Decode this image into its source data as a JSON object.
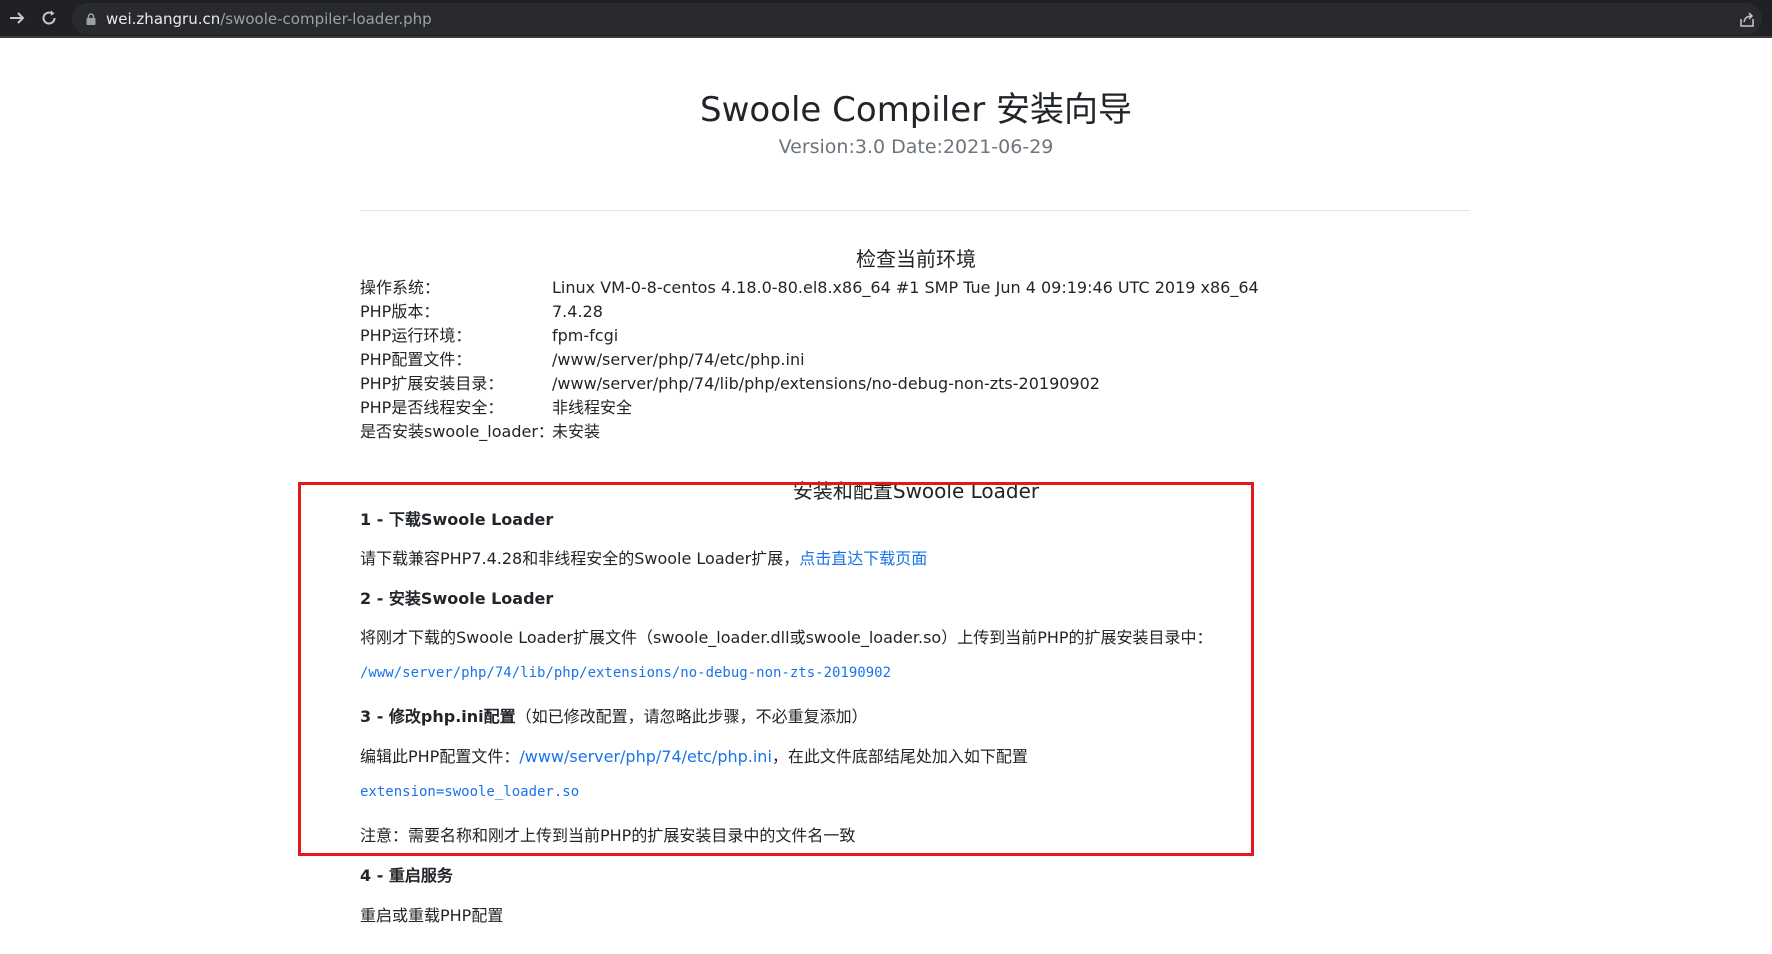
{
  "browser": {
    "url_host": "wei.zhangru.cn",
    "url_path": "/swoole-compiler-loader.php"
  },
  "header": {
    "title": "Swoole Compiler 安装向导",
    "subtitle": "Version:3.0 Date:2021-06-29"
  },
  "environment": {
    "title": "检查当前环境",
    "rows": [
      {
        "label": "操作系统：",
        "value": "Linux VM-0-8-centos 4.18.0-80.el8.x86_64 #1 SMP Tue Jun 4 09:19:46 UTC 2019 x86_64"
      },
      {
        "label": "PHP版本：",
        "value": "7.4.28"
      },
      {
        "label": "PHP运行环境：",
        "value": "fpm-fcgi"
      },
      {
        "label": "PHP配置文件：",
        "value": "/www/server/php/74/etc/php.ini"
      },
      {
        "label": "PHP扩展安装目录：",
        "value": "/www/server/php/74/lib/php/extensions/no-debug-non-zts-20190902"
      },
      {
        "label": "PHP是否线程安全：",
        "value": "非线程安全"
      },
      {
        "label": "是否安装swoole_loader：",
        "value": "未安装"
      }
    ]
  },
  "install": {
    "title": "安装和配置Swoole Loader",
    "step1": {
      "heading": "1 - 下载Swoole Loader",
      "text": "请下载兼容PHP7.4.28和非线程安全的Swoole Loader扩展，",
      "link": "点击直达下载页面"
    },
    "step2": {
      "heading": "2 - 安装Swoole Loader",
      "text": "将刚才下载的Swoole Loader扩展文件（swoole_loader.dll或swoole_loader.so）上传到当前PHP的扩展安装目录中：",
      "path": "/www/server/php/74/lib/php/extensions/no-debug-non-zts-20190902"
    },
    "step3": {
      "heading": "3 - 修改php.ini配置",
      "note": "（如已修改配置，请忽略此步骤，不必重复添加）",
      "text_before": "编辑此PHP配置文件：",
      "ini_link": "/www/server/php/74/etc/php.ini",
      "text_after": "，在此文件底部结尾处加入如下配置",
      "config": "extension=swoole_loader.so",
      "notice": "注意：需要名称和刚才上传到当前PHP的扩展安装目录中的文件名一致"
    },
    "step4": {
      "heading": "4 - 重启服务",
      "text": "重启或重载PHP配置"
    }
  }
}
